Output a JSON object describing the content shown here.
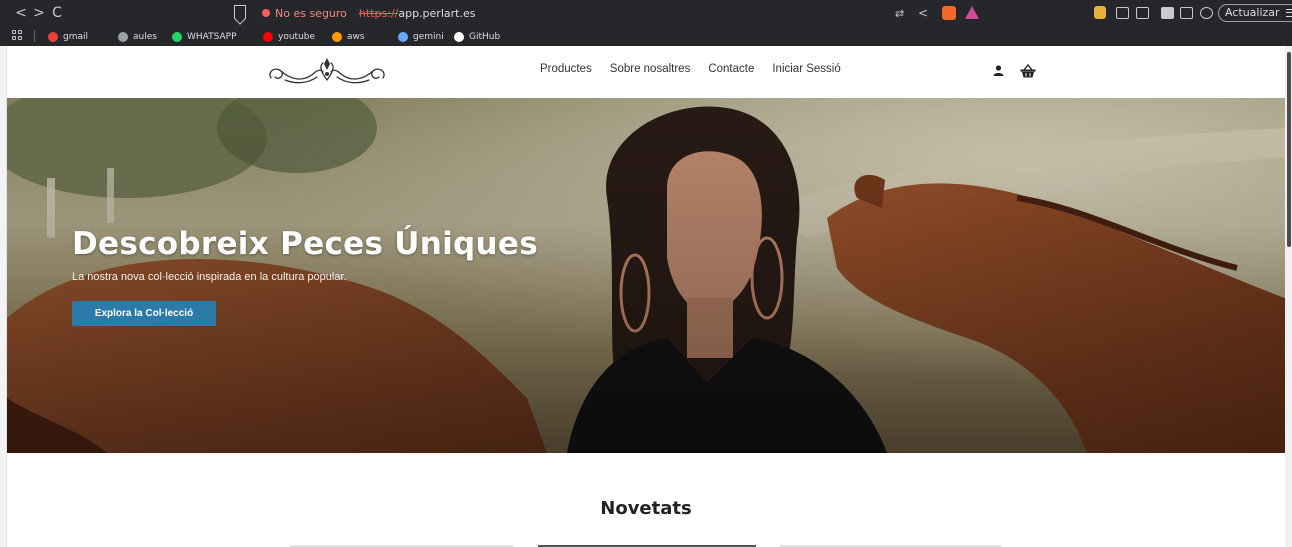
{
  "browser": {
    "nav": {
      "back": "<",
      "forward": ">",
      "reload": "C"
    },
    "security_label": "No es seguro",
    "url_scheme": "https://",
    "url_host": "app.perlart.es",
    "update_label": "Actualizar",
    "bookmarks": [
      {
        "label": "gmail",
        "icon": "gmail-icon",
        "color": "#ea4335"
      },
      {
        "label": "aules",
        "icon": "aules-icon",
        "color": "#9aa0a6"
      },
      {
        "label": "WHATSAPP",
        "icon": "whatsapp-icon",
        "color": "#25d366"
      },
      {
        "label": "youtube",
        "icon": "youtube-icon",
        "color": "#ff0000"
      },
      {
        "label": "aws",
        "icon": "aws-icon",
        "color": "#ff9900"
      },
      {
        "label": "gemini",
        "icon": "gemini-icon",
        "color": "#6aa7ff"
      },
      {
        "label": "GitHub",
        "icon": "github-icon",
        "color": "#ffffff"
      }
    ]
  },
  "site": {
    "logo": "ornamental-logo",
    "nav": [
      "Productes",
      "Sobre nosaltres",
      "Contacte",
      "Iniciar Sessió"
    ],
    "header_icons": [
      "user-icon",
      "basket-icon"
    ],
    "hero": {
      "title": "Descobreix Peces Úniques",
      "subtitle": "La nostra nova col·lecció inspirada en la cultura popular.",
      "cta": "Explora la Col·lecció"
    },
    "section_title": "Novetats"
  },
  "colors": {
    "chrome_bg": "#25272b",
    "cta_bg": "#2c7aa8",
    "insecure": "#f25f5c"
  }
}
